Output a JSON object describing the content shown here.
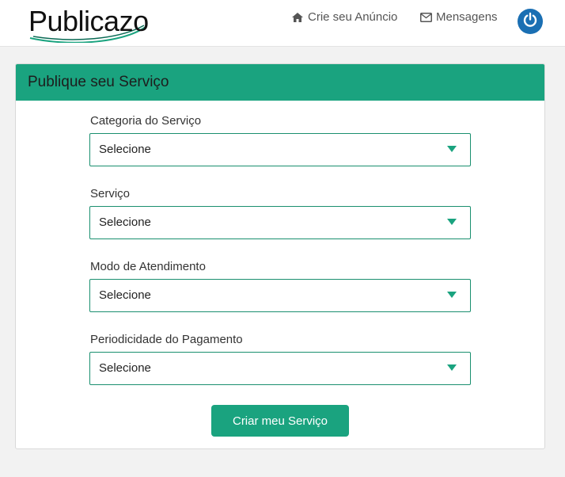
{
  "header": {
    "logo": "Publicazo",
    "nav": [
      {
        "label": "Crie seu Anúncio",
        "icon": "home-icon"
      },
      {
        "label": "Mensagens",
        "icon": "envelope-icon"
      }
    ],
    "power_icon": "power-icon"
  },
  "form": {
    "title": "Publique seu Serviço",
    "fields": [
      {
        "label": "Categoria do Serviço",
        "value": "Selecione"
      },
      {
        "label": "Serviço",
        "value": "Selecione"
      },
      {
        "label": "Modo de Atendimento",
        "value": "Selecione"
      },
      {
        "label": "Periodicidade do Pagamento",
        "value": "Selecione"
      }
    ],
    "submit_label": "Criar meu Serviço"
  },
  "colors": {
    "accent": "#1aa37f",
    "power_button": "#1a6fb3",
    "background": "#f2f2f2"
  }
}
